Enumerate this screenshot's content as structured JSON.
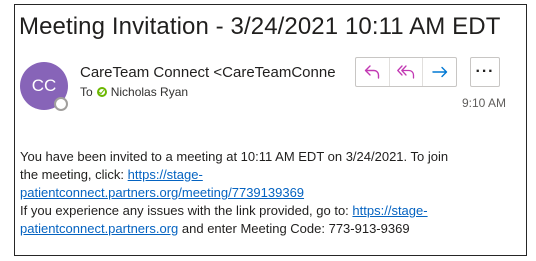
{
  "email": {
    "subject": "Meeting Invitation - 3/24/2021 10:11 AM EDT",
    "avatar_initials": "CC",
    "sender": "CareTeam Connect <CareTeamConne",
    "to_label": "To",
    "recipient": "Nicholas Ryan",
    "time": "9:10 AM",
    "actions": {
      "reply_icon": "reply-icon",
      "reply_all_icon": "reply-all-icon",
      "forward_icon": "forward-icon",
      "more_label": "···"
    },
    "body": {
      "line1": "You have been invited to a meeting at 10:11 AM EDT on 3/24/2021. To join",
      "line2_text": "the meeting, click: ",
      "link1_part1": "https://stage-",
      "link1_part2": "patientconnect.partners.org/meeting/7739139369",
      "line4_text": "If you experience any issues with the link provided, go to: ",
      "link2_part1": "https://stage-",
      "link2_part2": "patientconnect.partners.org",
      "line5_suffix": " and enter Meeting Code: 773-913-9369"
    }
  },
  "colors": {
    "avatar": "#8764b8",
    "reply_icons": "#c239b3",
    "forward_icon": "#0078d4",
    "presence": "#6bb700",
    "link": "#0563c1"
  }
}
